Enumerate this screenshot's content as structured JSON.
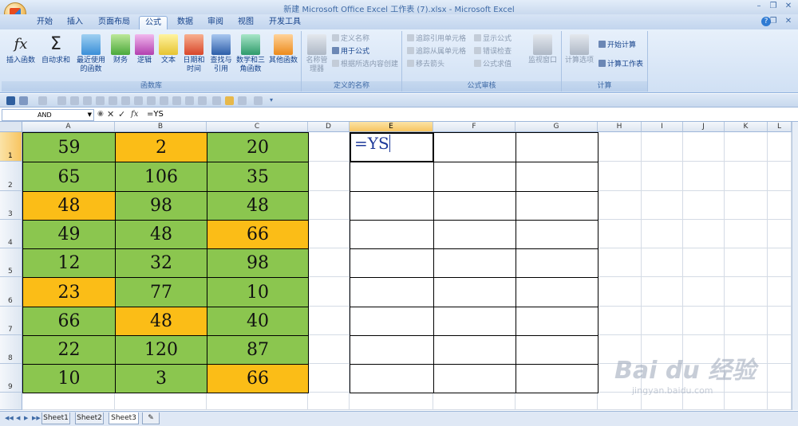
{
  "window": {
    "title": "新建 Microsoft Office Excel 工作表 (7).xlsx - Microsoft Excel",
    "minimize": "–",
    "restore": "❐",
    "close": "✕",
    "help": "?"
  },
  "ribbon_tabs": [
    "开始",
    "插入",
    "页面布局",
    "公式",
    "数据",
    "审阅",
    "视图",
    "开发工具"
  ],
  "active_tab": "公式",
  "ribbon": {
    "function_library": {
      "label": "函数库",
      "buttons": [
        {
          "label": "插入函数",
          "icon": "fx-icon"
        },
        {
          "label": "自动求和",
          "icon": "sigma-icon"
        },
        {
          "label": "最近使用的函数",
          "icon": "book-blue-icon"
        },
        {
          "label": "财务",
          "icon": "book-green-icon"
        },
        {
          "label": "逻辑",
          "icon": "book-purple-icon"
        },
        {
          "label": "文本",
          "icon": "book-yellow-icon"
        },
        {
          "label": "日期和时间",
          "icon": "book-red-icon"
        },
        {
          "label": "查找与引用",
          "icon": "book-navy-icon"
        },
        {
          "label": "数学和三角函数",
          "icon": "book-teal-icon"
        },
        {
          "label": "其他函数",
          "icon": "book-orange-icon"
        }
      ]
    },
    "defined_names": {
      "label": "定义的名称",
      "big": "名称管理器",
      "items": [
        "定义名称",
        "用于公式",
        "根据所选内容创建"
      ]
    },
    "formula_auditing": {
      "label": "公式审核",
      "items": [
        "追踪引用单元格",
        "追踪从属单元格",
        "移去箭头",
        "显示公式",
        "错误检查",
        "公式求值"
      ],
      "big": "监视窗口"
    },
    "calculation": {
      "label": "计算",
      "big": "计算选项",
      "items": [
        "开始计算",
        "计算工作表"
      ]
    }
  },
  "formula_bar": {
    "name_box": "AND",
    "formula": "=YS",
    "cancel": "✕",
    "enter": "✓",
    "fx": "fx"
  },
  "columns": [
    "A",
    "B",
    "C",
    "D",
    "E",
    "F",
    "G",
    "H",
    "I",
    "J",
    "K",
    "L"
  ],
  "rows": [
    "1",
    "2",
    "3",
    "4",
    "5",
    "6",
    "7",
    "8",
    "9"
  ],
  "table": [
    [
      {
        "v": "59",
        "c": "green"
      },
      {
        "v": "2",
        "c": "orange"
      },
      {
        "v": "20",
        "c": "green"
      }
    ],
    [
      {
        "v": "65",
        "c": "green"
      },
      {
        "v": "106",
        "c": "green"
      },
      {
        "v": "35",
        "c": "green"
      }
    ],
    [
      {
        "v": "48",
        "c": "orange"
      },
      {
        "v": "98",
        "c": "green"
      },
      {
        "v": "48",
        "c": "green"
      }
    ],
    [
      {
        "v": "49",
        "c": "green"
      },
      {
        "v": "48",
        "c": "green"
      },
      {
        "v": "66",
        "c": "orange"
      }
    ],
    [
      {
        "v": "12",
        "c": "green"
      },
      {
        "v": "32",
        "c": "green"
      },
      {
        "v": "98",
        "c": "green"
      }
    ],
    [
      {
        "v": "23",
        "c": "orange"
      },
      {
        "v": "77",
        "c": "green"
      },
      {
        "v": "10",
        "c": "green"
      }
    ],
    [
      {
        "v": "66",
        "c": "green"
      },
      {
        "v": "48",
        "c": "orange"
      },
      {
        "v": "40",
        "c": "green"
      }
    ],
    [
      {
        "v": "22",
        "c": "green"
      },
      {
        "v": "120",
        "c": "green"
      },
      {
        "v": "87",
        "c": "green"
      }
    ],
    [
      {
        "v": "10",
        "c": "green"
      },
      {
        "v": "3",
        "c": "green"
      },
      {
        "v": "66",
        "c": "orange"
      }
    ]
  ],
  "colors": {
    "green": "#8bc64f",
    "orange": "#fbbd17"
  },
  "active_cell": {
    "ref": "E1",
    "value": "=YS"
  },
  "sheets": [
    "Sheet1",
    "Sheet2",
    "Sheet3"
  ],
  "active_sheet": "Sheet3",
  "watermark": {
    "main": "Bai du 经验",
    "sub": "jingyan.baidu.com"
  }
}
